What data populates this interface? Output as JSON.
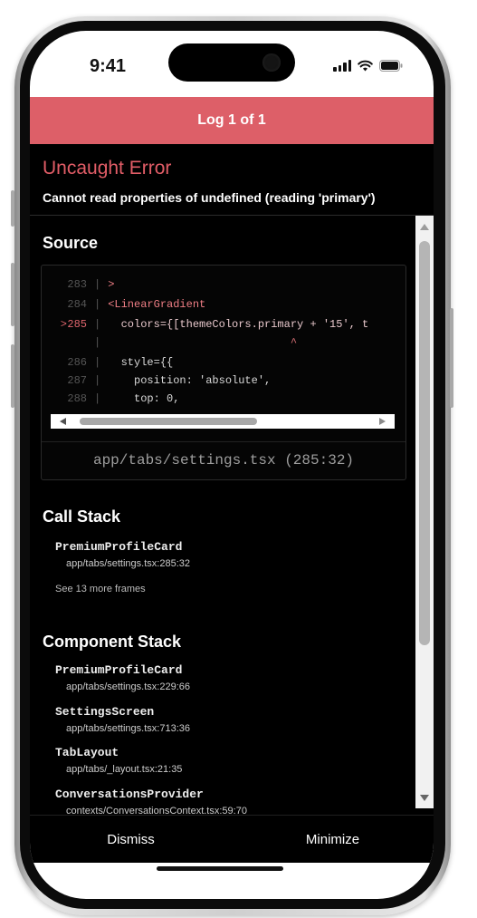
{
  "status_bar": {
    "time": "9:41"
  },
  "header": {
    "title": "Log 1 of 1"
  },
  "error": {
    "title": "Uncaught Error",
    "message": "Cannot read properties of undefined (reading 'primary')"
  },
  "source": {
    "title": "Source",
    "lines": [
      {
        "marker": "",
        "num": "283",
        "text": ">"
      },
      {
        "marker": "",
        "num": "284",
        "text": "<LinearGradient"
      },
      {
        "marker": ">",
        "num": "285",
        "text": "  colors={[themeColors.primary + '15', t"
      },
      {
        "marker": "",
        "num": "",
        "text": "                            ^"
      },
      {
        "marker": "",
        "num": "286",
        "text": "  style={{"
      },
      {
        "marker": "",
        "num": "287",
        "text": "    position: 'absolute',"
      },
      {
        "marker": "",
        "num": "288",
        "text": "    top: 0,"
      }
    ],
    "file": "app/tabs/settings.tsx (285:32)"
  },
  "call_stack": {
    "title": "Call Stack",
    "frames": [
      {
        "name": "PremiumProfileCard",
        "location": "app/tabs/settings.tsx:285:32"
      }
    ],
    "see_more": "See 13 more frames"
  },
  "component_stack": {
    "title": "Component Stack",
    "frames": [
      {
        "name": "PremiumProfileCard",
        "location": "app/tabs/settings.tsx:229:66"
      },
      {
        "name": "SettingsScreen",
        "location": "app/tabs/settings.tsx:713:36"
      },
      {
        "name": "TabLayout",
        "location": "app/tabs/_layout.tsx:21:35"
      },
      {
        "name": "ConversationsProvider",
        "location": "contexts/ConversationsContext.tsx:59:70"
      }
    ]
  },
  "footer": {
    "dismiss": "Dismiss",
    "minimize": "Minimize"
  },
  "colors": {
    "accent": "#dd5f68",
    "error_text": "#e25d67",
    "background": "#000000"
  },
  "icons": [
    "cellular-signal-icon",
    "wifi-icon",
    "battery-icon",
    "scroll-left-icon",
    "scroll-right-icon",
    "scroll-up-icon",
    "scroll-down-icon"
  ]
}
